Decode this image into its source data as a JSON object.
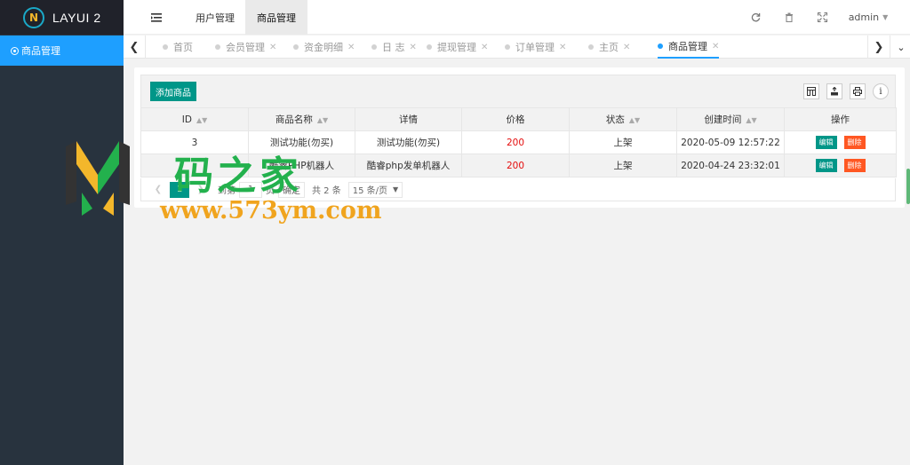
{
  "app": {
    "logo_text": "LAYUI 2",
    "logo_letter": "N"
  },
  "sidebar": {
    "items": [
      {
        "label": "商品管理",
        "active": true
      }
    ]
  },
  "header": {
    "menu_icon": "menu-toggle-icon",
    "nav": [
      {
        "label": "用户管理",
        "active": false
      },
      {
        "label": "商品管理",
        "active": true
      }
    ],
    "user": "admin",
    "icons": [
      "refresh-icon",
      "trash-icon",
      "fullscreen-icon",
      "caret-down-icon"
    ]
  },
  "tabs": [
    {
      "label": "首页",
      "closable": false,
      "active": false
    },
    {
      "label": "会员管理",
      "closable": true,
      "active": false
    },
    {
      "label": "资金明细",
      "closable": true,
      "active": false
    },
    {
      "label": "日 志",
      "closable": true,
      "active": false
    },
    {
      "label": "提现管理",
      "closable": true,
      "active": false
    },
    {
      "label": "订单管理",
      "closable": true,
      "active": false
    },
    {
      "label": "主页",
      "closable": true,
      "active": false
    },
    {
      "label": "商品管理",
      "closable": true,
      "active": true
    }
  ],
  "toolbar": {
    "add_label": "添加商品",
    "icons": [
      "columns-filter-icon",
      "export-icon",
      "print-icon",
      "info-icon"
    ]
  },
  "table": {
    "columns": [
      {
        "label": "ID",
        "sortable": true
      },
      {
        "label": "商品名称",
        "sortable": true
      },
      {
        "label": "详情",
        "sortable": false
      },
      {
        "label": "价格",
        "sortable": false
      },
      {
        "label": "状态",
        "sortable": true
      },
      {
        "label": "创建时间",
        "sortable": true
      },
      {
        "label": "操作",
        "sortable": false
      }
    ],
    "rows": [
      {
        "id": "3",
        "name": "测试功能(勿买)",
        "detail": "测试功能(勿买)",
        "price": "200",
        "status": "上架",
        "created": "2020-05-09 12:57:22"
      },
      {
        "id": "",
        "name": "酷睿PHP机器人",
        "detail": "酷睿php发单机器人",
        "price": "200",
        "status": "上架",
        "created": "2020-04-24 23:32:01"
      }
    ],
    "actions": {
      "edit": "编辑",
      "delete": "删除"
    }
  },
  "pager": {
    "current": "1",
    "goto_prefix": "到第",
    "goto_value": "1",
    "goto_suffix": "页",
    "confirm": "确定",
    "total": "共 2 条",
    "page_size": "15 条/页"
  },
  "watermark": {
    "text_cn": "码之家",
    "url": "www.573ym.com"
  },
  "colors": {
    "sidebar_bg": "#28333e",
    "logo_bg": "#20222a",
    "active_blue": "#1e9fff",
    "primary_green": "#009688",
    "danger": "#ff5722",
    "price_red": "#e40d0d"
  }
}
